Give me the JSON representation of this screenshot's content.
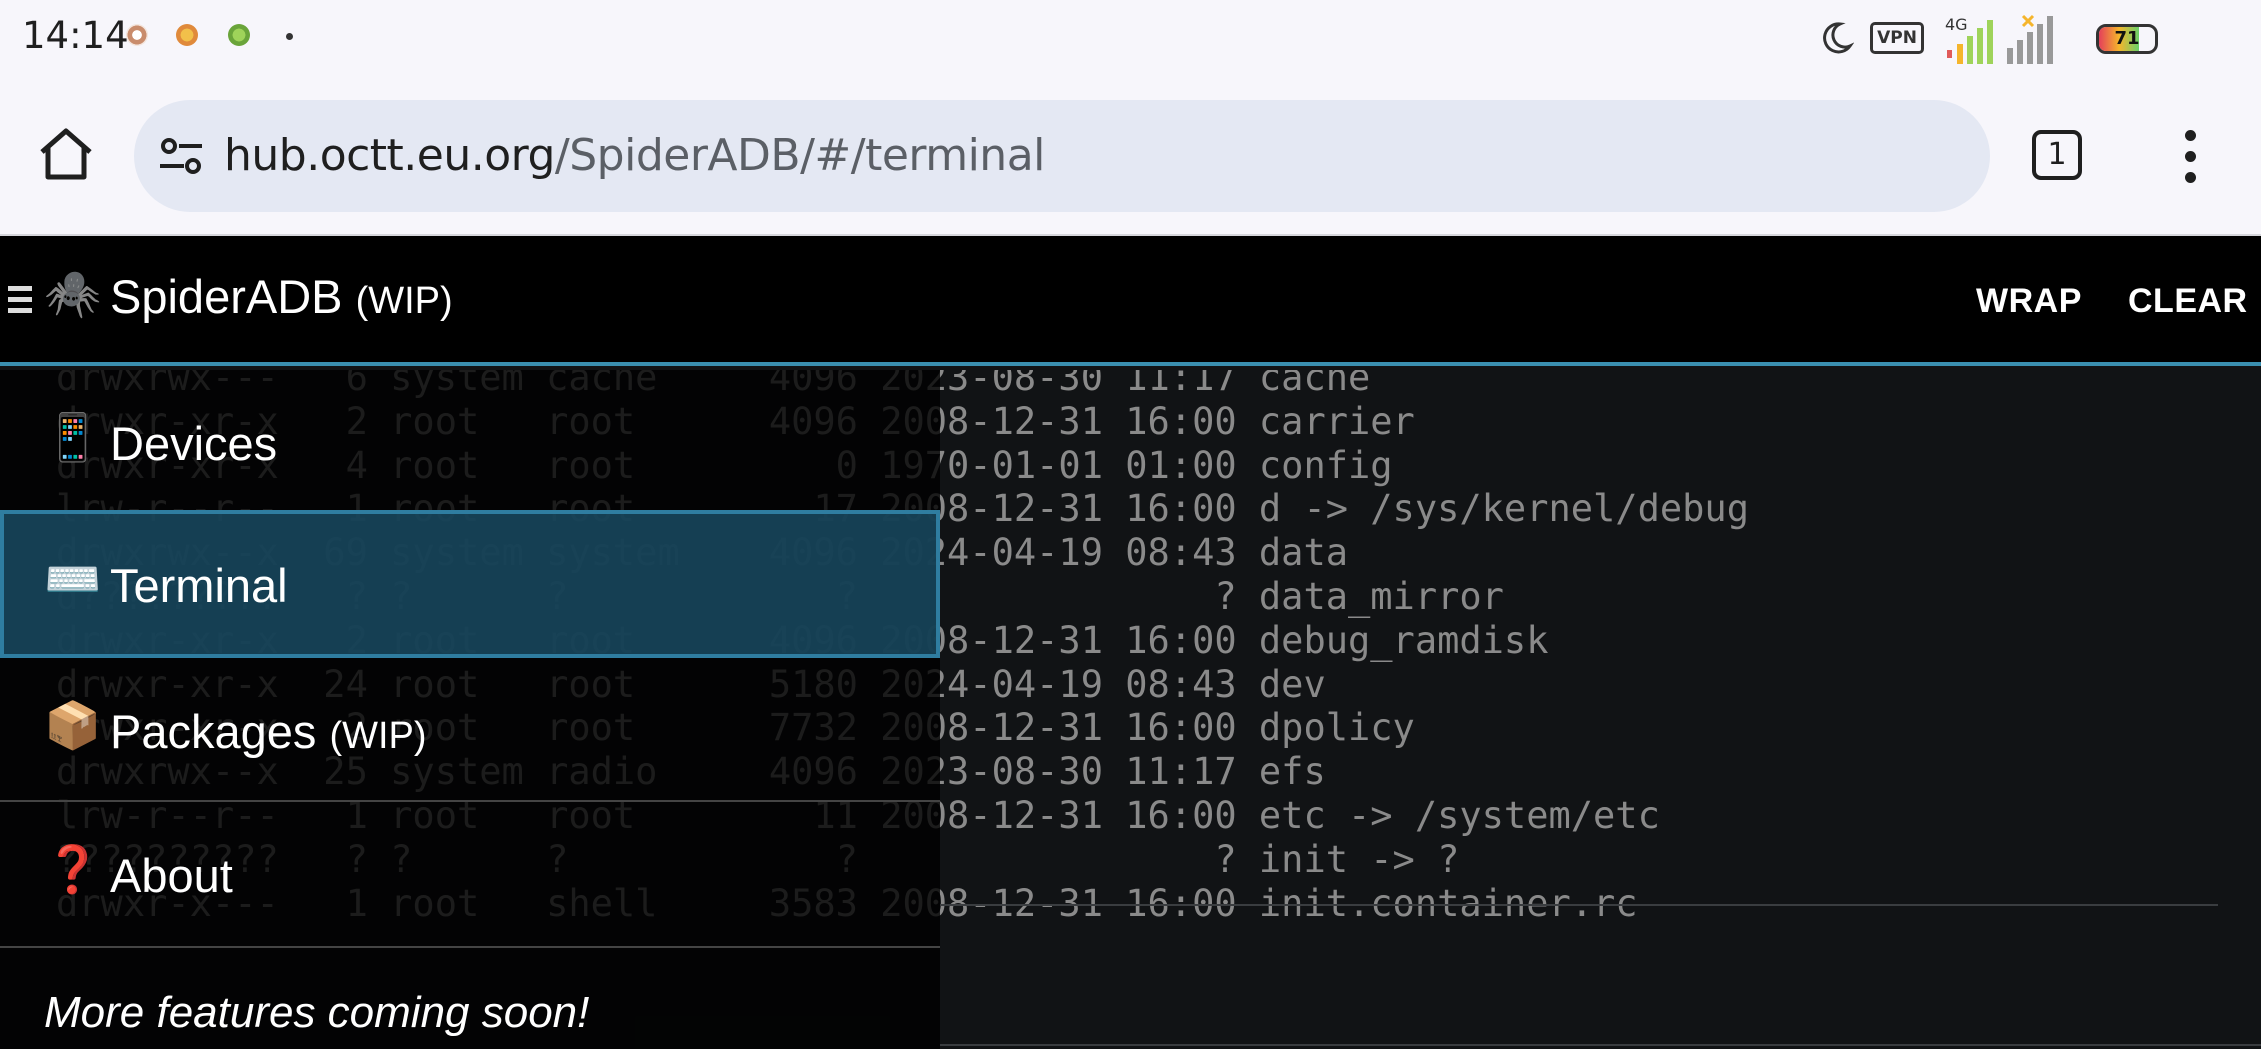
{
  "status_bar": {
    "time": "14:14",
    "vpn_label": "VPN",
    "network_type": "4G",
    "battery_level": "71",
    "battery_fraction": 0.71
  },
  "browser": {
    "url_host": "hub.octt.eu.org",
    "url_path": "/SpiderADB/#/terminal",
    "tab_count": "1"
  },
  "app": {
    "title": "SpiderADB",
    "title_suffix": "(WIP)",
    "spider_emoji": "🕷️",
    "actions": {
      "wrap": "WRAP",
      "clear": "CLEAR"
    }
  },
  "drawer": {
    "items": [
      {
        "icon": "📱",
        "label": "Devices",
        "suffix": ""
      },
      {
        "icon": "⌨️",
        "label": "Terminal",
        "suffix": "",
        "active": true
      },
      {
        "icon": "📦",
        "label": "Packages",
        "suffix": "(WIP)"
      },
      {
        "icon": "❓",
        "label": "About",
        "suffix": ""
      }
    ],
    "footer": "More features coming soon!"
  },
  "terminal": {
    "lines": [
      "drwxrwx---   6 system cache     4096 2023-08-30 11:17 cache",
      "drwxr-xr-x   2 root   root      4096 2008-12-31 16:00 carrier",
      "drwxr-xr-x   4 root   root         0 1970-01-01 01:00 config",
      "lrw-r--r--   1 root   root        17 2008-12-31 16:00 d -> /sys/kernel/debug",
      "drwxrwx--x  69 system system    4096 2024-04-19 08:43 data",
      "d?????????   ? ?      ?            ?                ? data_mirror",
      "drwxr-xr-x   2 root   root      4096 2008-12-31 16:00 debug_ramdisk",
      "drwxr-xr-x  24 root   root      5180 2024-04-19 08:43 dev",
      "drwxr-xr-x   2 root   root      7732 2008-12-31 16:00 dpolicy",
      "drwxrwx--x  25 system radio     4096 2023-08-30 11:17 efs",
      "lrw-r--r--   1 root   root        11 2008-12-31 16:00 etc -> /system/etc",
      "??????????   ? ?      ?            ?                ? init -> ?",
      "drwxr-x---   1 root   shell     3583 2008-12-31 16:00 init.container.rc"
    ]
  }
}
